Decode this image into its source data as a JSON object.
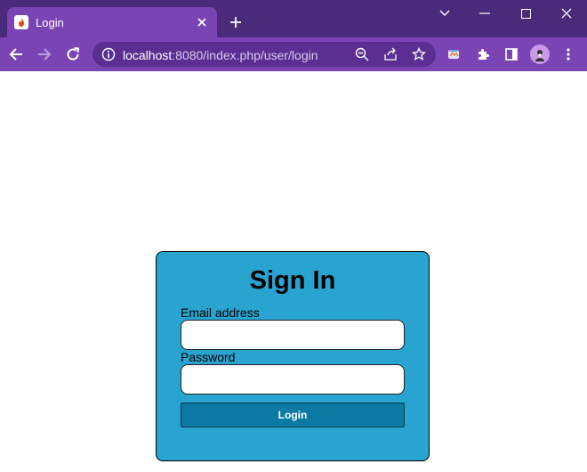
{
  "browser": {
    "tab": {
      "title": "Login",
      "favicon": "codeigniter-flame-icon"
    },
    "url": {
      "host": "localhost",
      "rest": ":8080/index.php/user/login"
    },
    "colors": {
      "frame": "#4a2a7a",
      "toolbar": "#7a44b5",
      "omnibox": "#5b2f91"
    }
  },
  "login_form": {
    "title": "Sign In",
    "email_label": "Email address",
    "email_value": "",
    "password_label": "Password",
    "password_value": "",
    "submit_label": "Login",
    "colors": {
      "card": "#29a3cf",
      "button": "#0b7aa3"
    }
  }
}
